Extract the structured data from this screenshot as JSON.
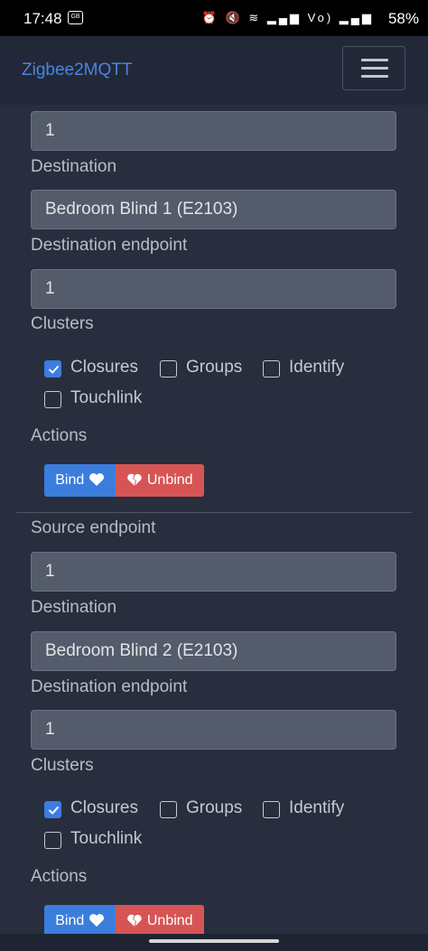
{
  "status_bar": {
    "time": "17:48",
    "notification_badge": "GB",
    "icons": [
      "alarm-icon",
      "mute-icon",
      "wifi-icon",
      "signal-icon",
      "volte-icon",
      "signal-icon"
    ],
    "icons_text": "⏰ 🔇 ≋ ▂▄▆ Vo) ▂▄▆",
    "battery": "58%"
  },
  "navbar": {
    "brand": "Zigbee2MQTT",
    "brand_color": "#4a84e0"
  },
  "bindings": [
    {
      "source_endpoint_value": "1",
      "destination_label": "Destination",
      "destination_value": "Bedroom Blind 1 (E2103)",
      "destination_endpoint_label": "Destination endpoint",
      "destination_endpoint_value": "1",
      "clusters_label": "Clusters",
      "clusters": [
        {
          "label": "Closures",
          "checked": true
        },
        {
          "label": "Groups",
          "checked": false
        },
        {
          "label": "Identify",
          "checked": false
        },
        {
          "label": "Touchlink",
          "checked": false
        }
      ],
      "actions_label": "Actions",
      "bind_label": "Bind",
      "unbind_label": "Unbind"
    },
    {
      "source_endpoint_label": "Source endpoint",
      "source_endpoint_value": "1",
      "destination_label": "Destination",
      "destination_value": "Bedroom Blind 2 (E2103)",
      "destination_endpoint_label": "Destination endpoint",
      "destination_endpoint_value": "1",
      "clusters_label": "Clusters",
      "clusters": [
        {
          "label": "Closures",
          "checked": true
        },
        {
          "label": "Groups",
          "checked": false
        },
        {
          "label": "Identify",
          "checked": false
        },
        {
          "label": "Touchlink",
          "checked": false
        }
      ],
      "actions_label": "Actions",
      "bind_label": "Bind",
      "unbind_label": "Unbind"
    }
  ],
  "colors": {
    "bind": "#3b7ddd",
    "unbind": "#d75454",
    "checked": "#3d7de0"
  }
}
